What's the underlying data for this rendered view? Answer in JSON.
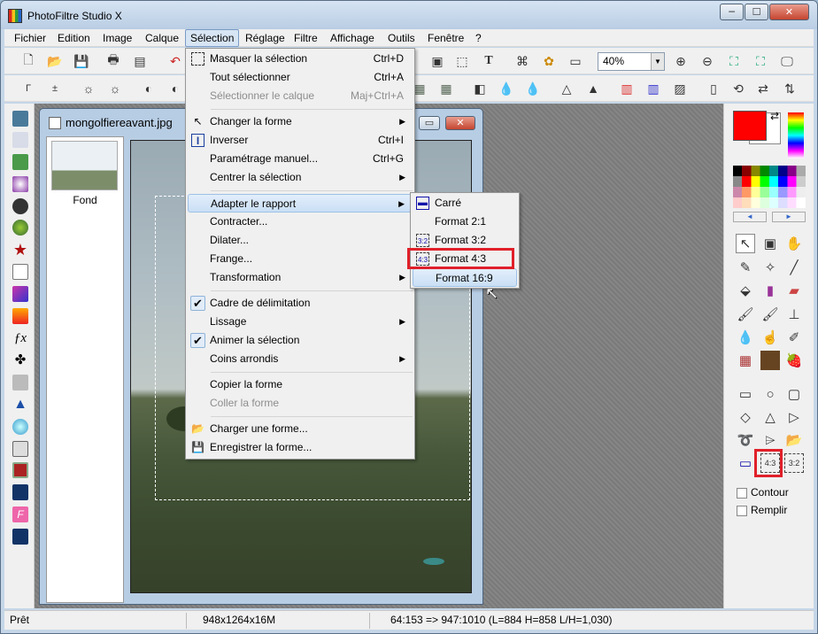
{
  "window": {
    "title": "PhotoFiltre Studio X",
    "btn_min": "─",
    "btn_max": "☐",
    "btn_close": "✕"
  },
  "menubar": [
    "Fichier",
    "Edition",
    "Image",
    "Calque",
    "Sélection",
    "Réglage",
    "Filtre",
    "Affichage",
    "Outils",
    "Fenêtre",
    "?"
  ],
  "zoom": {
    "value": "40%"
  },
  "document": {
    "title": "mongolfiereavant.jpg",
    "layer_name": "Fond"
  },
  "selection_menu": [
    {
      "label": "Masquer la sélection",
      "shortcut": "Ctrl+D",
      "icon": "selection-icon"
    },
    {
      "label": "Tout sélectionner",
      "shortcut": "Ctrl+A"
    },
    {
      "label": "Sélectionner le calque",
      "shortcut": "Maj+Ctrl+A",
      "disabled": true
    },
    {
      "label": "Changer la forme",
      "submenu": true,
      "icon": "cursor-icon"
    },
    {
      "label": "Inverser",
      "shortcut": "Ctrl+I",
      "icon": "invert-icon"
    },
    {
      "label": "Paramétrage manuel...",
      "shortcut": "Ctrl+G"
    },
    {
      "label": "Centrer la sélection",
      "submenu": true
    },
    {
      "label": "Adapter le rapport",
      "submenu": true,
      "highlighted": true
    },
    {
      "label": "Contracter..."
    },
    {
      "label": "Dilater..."
    },
    {
      "label": "Frange..."
    },
    {
      "label": "Transformation",
      "submenu": true
    },
    {
      "label": "Cadre de délimitation",
      "checked": true
    },
    {
      "label": "Lissage",
      "submenu": true
    },
    {
      "label": "Animer la sélection",
      "checked": true
    },
    {
      "label": "Coins arrondis",
      "submenu": true
    },
    {
      "label": "Copier la forme"
    },
    {
      "label": "Coller la forme",
      "disabled": true
    },
    {
      "label": "Charger une forme...",
      "icon": "folder-icon"
    },
    {
      "label": "Enregistrer la forme...",
      "icon": "save-icon"
    }
  ],
  "ratio_submenu": [
    {
      "label": "Carré",
      "icon": "square-ratio-icon"
    },
    {
      "label": "Format 2:1"
    },
    {
      "label": "Format 3:2",
      "icon_text": "3:2"
    },
    {
      "label": "Format 4:3",
      "icon_text": "4:3",
      "boxed": true
    },
    {
      "label": "Format 16:9",
      "highlighted": true
    }
  ],
  "right_panel": {
    "contour_label": "Contour",
    "fill_label": "Remplir",
    "ratio_43": "4:3",
    "ratio_32": "3:2",
    "fg_color": "#ff0000",
    "bg_color": "#ffffff",
    "nav_left": "◄",
    "nav_right": "►"
  },
  "status": {
    "ready": "Prêt",
    "size": "948x1264x16M",
    "coords": "64:153 => 947:1010 (L=884  H=858  L/H=1,030)"
  }
}
